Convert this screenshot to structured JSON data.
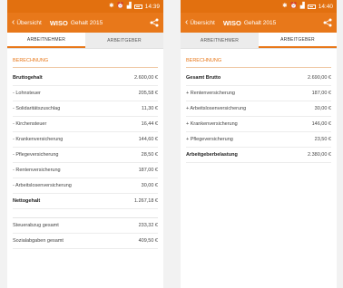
{
  "left": {
    "status": {
      "time": "14:39"
    },
    "appbar": {
      "back_label": "Übersicht",
      "title_strong": "WISO",
      "title_sub": "Gehalt 2015"
    },
    "tabs": [
      {
        "label": "ARBEITNEHMER",
        "active": true
      },
      {
        "label": "ARBEITGEBER",
        "active": false
      }
    ],
    "section": "BERECHNUNG",
    "rows": [
      {
        "label": "Bruttogehalt",
        "value": "2.600,00 €",
        "bold": true
      },
      {
        "label": "- Lohnsteuer",
        "value": "205,58 €",
        "bold": false
      },
      {
        "label": "- Solidaritätszuschlag",
        "value": "11,30 €",
        "bold": false
      },
      {
        "label": "- Kirchensteuer",
        "value": "16,44 €",
        "bold": false
      },
      {
        "label": "- Krankenversicherung",
        "value": "144,60 €",
        "bold": false
      },
      {
        "label": "- Pflegeversicherung",
        "value": "28,50 €",
        "bold": false
      },
      {
        "label": "- Rentenversicherung",
        "value": "187,00 €",
        "bold": false
      },
      {
        "label": "- Arbeitslosenversicherung",
        "value": "30,00 €",
        "bold": false
      },
      {
        "label": "Nettogehalt",
        "value": "1.267,18 €",
        "bold": true
      }
    ],
    "rows2": [
      {
        "label": "Steuerabzug gesamt",
        "value": "233,32 €",
        "bold": false
      },
      {
        "label": "Sozialabgaben gesamt",
        "value": "409,50 €",
        "bold": false
      }
    ]
  },
  "right": {
    "status": {
      "time": "14:40"
    },
    "appbar": {
      "back_label": "Übersicht",
      "title_strong": "WISO",
      "title_sub": "Gehalt 2015"
    },
    "tabs": [
      {
        "label": "ARBEITNEHMER",
        "active": false
      },
      {
        "label": "ARBEITGEBER",
        "active": true
      }
    ],
    "section": "BERECHNUNG",
    "rows": [
      {
        "label": "Gesamt Brutto",
        "value": "2.690,00 €",
        "bold": true
      },
      {
        "label": "+ Rentenversicherung",
        "value": "187,00 €",
        "bold": false
      },
      {
        "label": "+ Arbeitslosenversicherung",
        "value": "30,00 €",
        "bold": false
      },
      {
        "label": "+ Krankenversicherung",
        "value": "146,00 €",
        "bold": false
      },
      {
        "label": "+ Pflegeversicherung",
        "value": "23,50 €",
        "bold": false
      },
      {
        "label": "Arbeitgeberbelastung",
        "value": "2.380,00 €",
        "bold": true
      }
    ]
  },
  "colors": {
    "accent": "#e8781a",
    "status_bar": "#e2700f"
  }
}
